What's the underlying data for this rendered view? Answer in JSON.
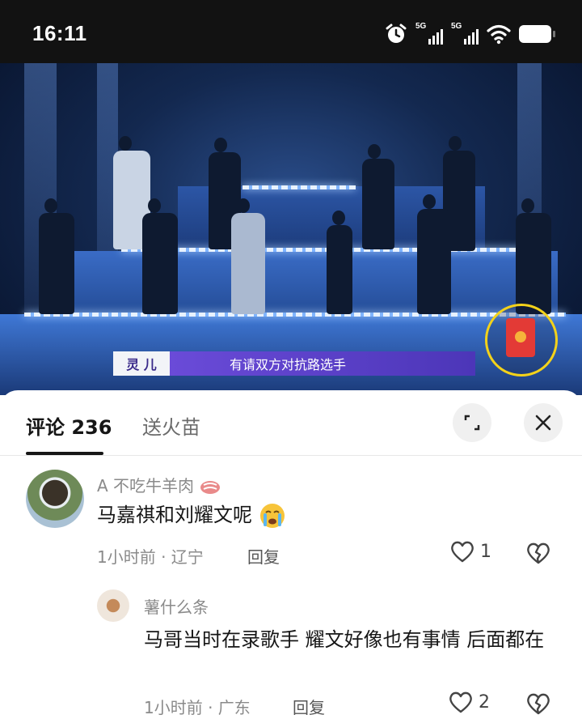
{
  "status_bar": {
    "time": "16:11",
    "network_1": "5G",
    "network_2": "5G",
    "icons": [
      "alarm-icon",
      "signal-icon",
      "signal-icon",
      "wifi-icon",
      "battery-icon"
    ]
  },
  "video": {
    "caption_name": "灵 儿",
    "caption_text": "有请双方对抗路选手",
    "overlay_icon": "red-envelope-icon"
  },
  "panel": {
    "tab_comments_label": "评论",
    "tab_comments_count": "236",
    "tab_gift_label": "送火苗",
    "expand_icon": "expand-icon",
    "close_icon": "close-icon"
  },
  "comments": [
    {
      "username": "A 不吃牛羊肉",
      "badge_icon": "meat-emoji-icon",
      "text": "马嘉祺和刘耀文呢",
      "emoji_icon": "crying-face-emoji-icon",
      "meta": "1小时前 · 辽宁",
      "reply": "回复",
      "likes": "1"
    },
    {
      "username": "薯什么条",
      "text": "马哥当时在录歌手 耀文好像也有事情 后面都在",
      "meta": "1小时前 · 广东",
      "reply": "回复",
      "likes": "2"
    }
  ]
}
